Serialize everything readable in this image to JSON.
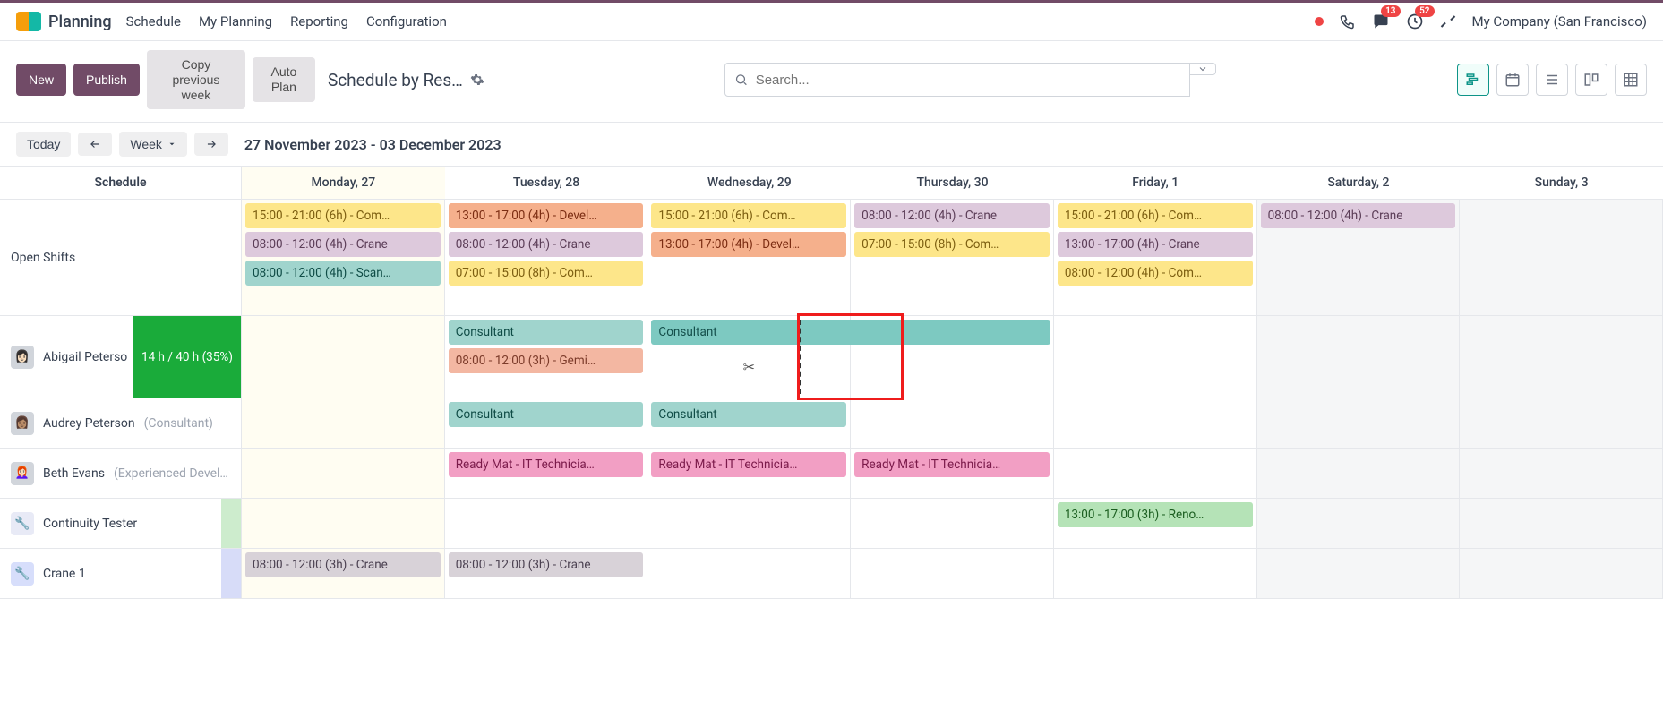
{
  "brand": "Planning",
  "nav": {
    "schedule": "Schedule",
    "myplanning": "My Planning",
    "reporting": "Reporting",
    "configuration": "Configuration"
  },
  "systray": {
    "messages_badge": "13",
    "activities_badge": "52"
  },
  "company": "My Company (San Francisco)",
  "buttons": {
    "new": "New",
    "publish": "Publish",
    "copy": "Copy previous week",
    "auto": "Auto Plan"
  },
  "page_title": "Schedule by Res…",
  "search": {
    "placeholder": "Search..."
  },
  "datebar": {
    "today": "Today",
    "range_label": "Week",
    "range_text": "27 November 2023 - 03 December 2023"
  },
  "columns": {
    "schedule": "Schedule",
    "d0": "Monday, 27",
    "d1": "Tuesday, 28",
    "d2": "Wednesday, 29",
    "d3": "Thursday, 30",
    "d4": "Friday, 1",
    "d5": "Saturday, 2",
    "d6": "Sunday, 3"
  },
  "rows": {
    "open": {
      "label": "Open Shifts"
    },
    "abigail": {
      "name": "Abigail Peterso",
      "hours": "14 h / 40 h (35%)"
    },
    "audrey": {
      "name": "Audrey Peterson",
      "role": "(Consultant)"
    },
    "beth": {
      "name": "Beth Evans",
      "role": "(Experienced Devel…"
    },
    "ct": {
      "name": "Continuity Tester"
    },
    "crane": {
      "name": "Crane 1"
    }
  },
  "shifts": {
    "open": {
      "d0": [
        {
          "t": "15:00 - 21:00 (6h) - Com…",
          "c": "c-yellow"
        },
        {
          "t": "08:00 - 12:00 (4h) - Crane",
          "c": "c-purple"
        },
        {
          "t": "08:00 - 12:00 (4h) - Scan…",
          "c": "c-tealsoft"
        }
      ],
      "d1": [
        {
          "t": "13:00 - 17:00 (4h) - Devel…",
          "c": "c-orange"
        },
        {
          "t": "08:00 - 12:00 (4h) - Crane",
          "c": "c-purple"
        },
        {
          "t": "07:00 - 15:00 (8h) - Com…",
          "c": "c-yellow"
        }
      ],
      "d2": [
        {
          "t": "15:00 - 21:00 (6h) - Com…",
          "c": "c-yellow"
        },
        {
          "t": "13:00 - 17:00 (4h) - Devel…",
          "c": "c-orange"
        }
      ],
      "d3": [
        {
          "t": "08:00 - 12:00 (4h) - Crane",
          "c": "c-purple"
        },
        {
          "t": "07:00 - 15:00 (8h) - Com…",
          "c": "c-yellow"
        }
      ],
      "d4": [
        {
          "t": "15:00 - 21:00 (6h) - Com…",
          "c": "c-yellow"
        },
        {
          "t": "13:00 - 17:00 (4h) - Crane",
          "c": "c-purple"
        },
        {
          "t": "08:00 - 12:00 (4h) - Com…",
          "c": "c-yellow"
        }
      ],
      "d5": [
        {
          "t": "08:00 - 12:00 (4h) - Crane",
          "c": "c-purple"
        }
      ]
    },
    "abigail": {
      "d1": [
        {
          "t": "Consultant",
          "c": "c-tealsoft"
        },
        {
          "t": "08:00 - 12:00 (3h) - Gemi…",
          "c": "c-salmon"
        }
      ],
      "d2_span": {
        "t": "Consultant",
        "c": "c-teal"
      }
    },
    "audrey": {
      "d1": [
        {
          "t": "Consultant",
          "c": "c-tealsoft"
        }
      ],
      "d2": [
        {
          "t": "Consultant",
          "c": "c-tealsoft"
        }
      ]
    },
    "beth": {
      "d1": [
        {
          "t": "Ready Mat - IT Technicia…",
          "c": "c-pink"
        }
      ],
      "d2": [
        {
          "t": "Ready Mat - IT Technicia…",
          "c": "c-pink"
        }
      ],
      "d3": [
        {
          "t": "Ready Mat - IT Technicia…",
          "c": "c-pink"
        }
      ]
    },
    "ct": {
      "d4": [
        {
          "t": "13:00 - 17:00 (3h) - Reno…",
          "c": "c-green"
        }
      ]
    },
    "crane": {
      "d0": [
        {
          "t": "08:00 - 12:00 (3h) - Crane",
          "c": "c-grey"
        }
      ],
      "d1": [
        {
          "t": "08:00 - 12:00 (3h) - Crane",
          "c": "c-grey"
        }
      ]
    }
  }
}
